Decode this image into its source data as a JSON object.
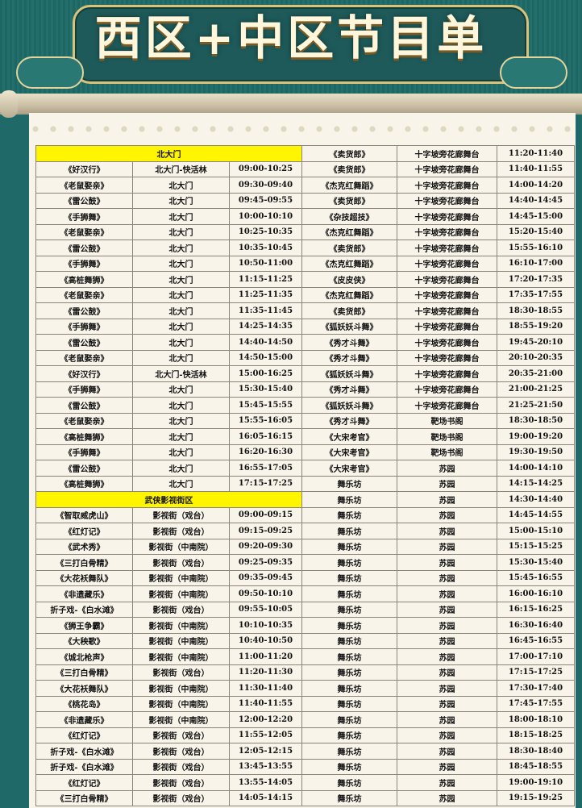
{
  "title": "西区+中区节目单",
  "colors": {
    "banner": "#1f6a68",
    "highlight": "#fff500",
    "paper": "#f8f4e9"
  },
  "sections": {
    "north_gate": "北大门",
    "wuxia": "武侠影视街区"
  },
  "left_rows": [
    [
      "《好汉行》",
      "北大门-快活林",
      "09:00-10:25"
    ],
    [
      "《老鼠娶亲》",
      "北大门",
      "09:30-09:40"
    ],
    [
      "《雷公鼓》",
      "北大门",
      "09:45-09:55"
    ],
    [
      "《手狮舞》",
      "北大门",
      "10:00-10:10"
    ],
    [
      "《老鼠娶亲》",
      "北大门",
      "10:25-10:35"
    ],
    [
      "《雷公鼓》",
      "北大门",
      "10:35-10:45"
    ],
    [
      "《手狮舞》",
      "北大门",
      "10:50-11:00"
    ],
    [
      "《高桩舞狮》",
      "北大门",
      "11:15-11:25"
    ],
    [
      "《老鼠娶亲》",
      "北大门",
      "11:25-11:35"
    ],
    [
      "《雷公鼓》",
      "北大门",
      "11:35-11:45"
    ],
    [
      "《手狮舞》",
      "北大门",
      "14:25-14:35"
    ],
    [
      "《雷公鼓》",
      "北大门",
      "14:40-14:50"
    ],
    [
      "《老鼠娶亲》",
      "北大门",
      "14:50-15:00"
    ],
    [
      "《好汉行》",
      "北大门-快活林",
      "15:00-16:25"
    ],
    [
      "《手狮舞》",
      "北大门",
      "15:30-15:40"
    ],
    [
      "《雷公鼓》",
      "北大门",
      "15:45-15:55"
    ],
    [
      "《老鼠娶亲》",
      "北大门",
      "15:55-16:05"
    ],
    [
      "《高桩舞狮》",
      "北大门",
      "16:05-16:15"
    ],
    [
      "《手狮舞》",
      "北大门",
      "16:20-16:30"
    ],
    [
      "《雷公鼓》",
      "北大门",
      "16:55-17:05"
    ],
    [
      "《高桩舞狮》",
      "北大门",
      "17:15-17:25"
    ],
    [
      "",
      "",
      ""
    ],
    [
      "《智取威虎山》",
      "影视街（戏台）",
      "09:00-09:15"
    ],
    [
      "《红灯记》",
      "影视街（戏台）",
      "09:15-09:25"
    ],
    [
      "《武术秀》",
      "影视街（中南院）",
      "09:20-09:30"
    ],
    [
      "《三打白骨精》",
      "影视街（戏台）",
      "09:25-09:35"
    ],
    [
      "《大花袄舞队》",
      "影视街（中南院）",
      "09:35-09:45"
    ],
    [
      "《非遗藏乐》",
      "影视街（中南院）",
      "09:50-10:10"
    ],
    [
      "折子戏-《白水滩》",
      "影视街（戏台）",
      "09:55-10:05"
    ],
    [
      "《狮王争霸》",
      "影视街（中南院）",
      "10:10-10:35"
    ],
    [
      "《大秧歌》",
      "影视街（中南院）",
      "10:40-10:50"
    ],
    [
      "《城北枪声》",
      "影视街（中南院）",
      "11:00-11:20"
    ],
    [
      "《三打白骨精》",
      "影视街（戏台）",
      "11:20-11:30"
    ],
    [
      "《大花袄舞队》",
      "影视街（中南院）",
      "11:30-11:40"
    ],
    [
      "《桃花岛》",
      "影视街（中南院）",
      "11:40-11:55"
    ],
    [
      "《非遗藏乐》",
      "影视街（中南院）",
      "12:00-12:20"
    ],
    [
      "《红灯记》",
      "影视街（戏台）",
      "11:55-12:05"
    ],
    [
      "折子戏-《白水滩》",
      "影视街（戏台）",
      "12:05-12:15"
    ],
    [
      "折子戏-《白水滩》",
      "影视街（戏台）",
      "13:45-13:55"
    ],
    [
      "《红灯记》",
      "影视街（戏台）",
      "13:55-14:05"
    ],
    [
      "《三打白骨精》",
      "影视街（戏台）",
      "14:05-14:15"
    ]
  ],
  "right_rows": [
    [
      "《卖货郎》",
      "十字坡旁花廊舞台",
      "11:20-11:40"
    ],
    [
      "《卖货郎》",
      "十字坡旁花廊舞台",
      "11:40-11:55"
    ],
    [
      "《杰克红舞蹈》",
      "十字坡旁花廊舞台",
      "14:00-14:20"
    ],
    [
      "《卖货郎》",
      "十字坡旁花廊舞台",
      "14:40-14:45"
    ],
    [
      "《杂技超技》",
      "十字坡旁花廊舞台",
      "14:45-15:00"
    ],
    [
      "《杰克红舞蹈》",
      "十字坡旁花廊舞台",
      "15:20-15:40"
    ],
    [
      "《卖货郎》",
      "十字坡旁花廊舞台",
      "15:55-16:10"
    ],
    [
      "《杰克红舞蹈》",
      "十字坡旁花廊舞台",
      "16:10-17:00"
    ],
    [
      "《皮皮侠》",
      "十字坡旁花廊舞台",
      "17:20-17:35"
    ],
    [
      "《杰克红舞蹈》",
      "十字坡旁花廊舞台",
      "17:35-17:55"
    ],
    [
      "《卖货郎》",
      "十字坡旁花廊舞台",
      "18:30-18:55"
    ],
    [
      "《狐妖妖斗舞》",
      "十字坡旁花廊舞台",
      "18:55-19:20"
    ],
    [
      "《秀才斗舞》",
      "十字坡旁花廊舞台",
      "19:45-20:10"
    ],
    [
      "《秀才斗舞》",
      "十字坡旁花廊舞台",
      "20:10-20:35"
    ],
    [
      "《狐妖妖斗舞》",
      "十字坡旁花廊舞台",
      "20:35-21:00"
    ],
    [
      "《秀才斗舞》",
      "十字坡旁花廊舞台",
      "21:00-21:25"
    ],
    [
      "《狐妖妖斗舞》",
      "十字坡旁花廊舞台",
      "21:25-21:50"
    ],
    [
      "《秀才斗舞》",
      "靶场书阁",
      "18:30-18:50"
    ],
    [
      "《大宋考官》",
      "靶场书阁",
      "19:00-19:20"
    ],
    [
      "《大宋考官》",
      "靶场书阁",
      "19:30-19:50"
    ],
    [
      "《大宋考官》",
      "苏园",
      "14:00-14:10"
    ],
    [
      "舞乐坊",
      "苏园",
      "14:15-14:25"
    ],
    [
      "舞乐坊",
      "苏园",
      "14:30-14:40"
    ],
    [
      "舞乐坊",
      "苏园",
      "14:45-14:55"
    ],
    [
      "舞乐坊",
      "苏园",
      "15:00-15:10"
    ],
    [
      "舞乐坊",
      "苏园",
      "15:15-15:25"
    ],
    [
      "舞乐坊",
      "苏园",
      "15:30-15:40"
    ],
    [
      "舞乐坊",
      "苏园",
      "15:45-16:55"
    ],
    [
      "舞乐坊",
      "苏园",
      "16:00-16:10"
    ],
    [
      "舞乐坊",
      "苏园",
      "16:15-16:25"
    ],
    [
      "舞乐坊",
      "苏园",
      "16:30-16:40"
    ],
    [
      "舞乐坊",
      "苏园",
      "16:45-16:55"
    ],
    [
      "舞乐坊",
      "苏园",
      "17:00-17:10"
    ],
    [
      "舞乐坊",
      "苏园",
      "17:15-17:25"
    ],
    [
      "舞乐坊",
      "苏园",
      "17:30-17:40"
    ],
    [
      "舞乐坊",
      "苏园",
      "17:45-17:55"
    ],
    [
      "舞乐坊",
      "苏园",
      "18:00-18:10"
    ],
    [
      "舞乐坊",
      "苏园",
      "18:15-18:25"
    ],
    [
      "舞乐坊",
      "苏园",
      "18:30-18:40"
    ],
    [
      "舞乐坊",
      "苏园",
      "18:45-18:55"
    ],
    [
      "舞乐坊",
      "苏园",
      "19:00-19:10"
    ],
    [
      "舞乐坊",
      "苏园",
      "19:15-19:25"
    ]
  ]
}
